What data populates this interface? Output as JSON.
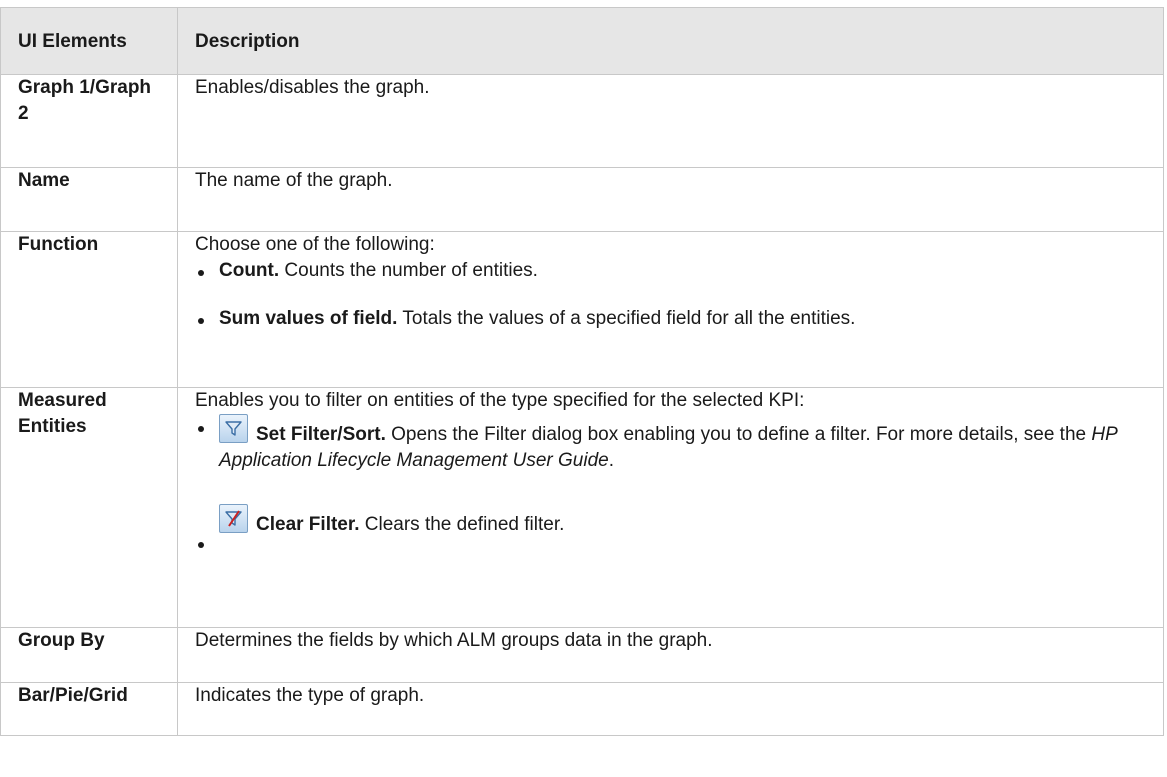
{
  "header": {
    "col1": "UI Elements",
    "col2": "Description"
  },
  "rows": {
    "graph": {
      "element": "Graph 1/Graph 2",
      "description": "Enables/disables the graph."
    },
    "name": {
      "element": "Name",
      "description": "The name of the graph."
    },
    "function": {
      "element": "Function",
      "intro": "Choose one of the following:",
      "items": [
        {
          "term": "Count.",
          "text": " Counts the number of entities."
        },
        {
          "term": "Sum values of field.",
          "text": " Totals the values of a specified field for all the entities."
        }
      ]
    },
    "measured": {
      "element": "Measured Entities",
      "intro": "Enables you to filter on entities of the type specified for the selected KPI:",
      "set_filter": {
        "icon": "filter-icon",
        "term": "Set Filter/Sort.",
        "text_before": " Opens the Filter dialog box enabling you to define a filter. For more details, see the ",
        "guide": "HP Application Lifecycle Management User Guide",
        "text_after": "."
      },
      "clear_filter": {
        "icon": "clear-filter-icon",
        "term": "Clear Filter.",
        "text": " Clears the defined filter."
      }
    },
    "group": {
      "element": "Group By",
      "description": "Determines the fields by which ALM groups data in the graph."
    },
    "bar": {
      "element": "Bar/Pie/Grid",
      "description": "Indicates the type of graph."
    }
  },
  "colors": {
    "header_bg": "#e6e6e6",
    "border": "#c8c8c8",
    "icon_blue": "#7a9fc4",
    "clear_red": "#cc2222"
  }
}
